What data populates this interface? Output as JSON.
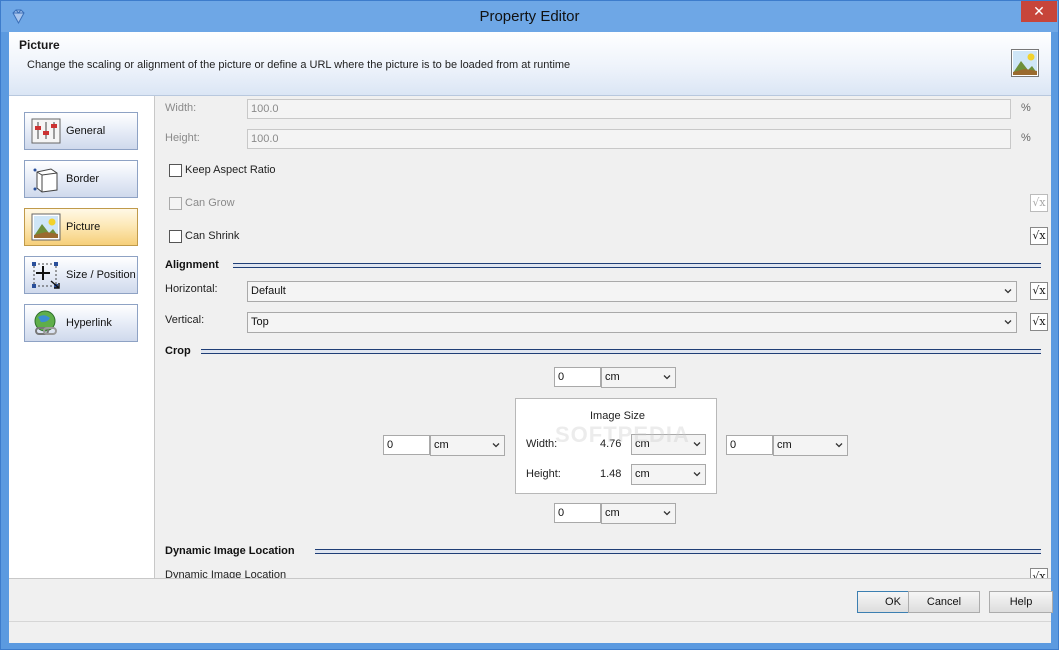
{
  "window": {
    "title": "Property Editor",
    "close_label": "✕"
  },
  "header": {
    "title": "Picture",
    "description": "Change the scaling or alignment of the picture or define a URL where the picture is to be loaded from at runtime"
  },
  "nav": {
    "items": [
      {
        "label": "General",
        "icon": "sliders-icon",
        "active": false
      },
      {
        "label": "Border",
        "icon": "border-box-icon",
        "active": false
      },
      {
        "label": "Picture",
        "icon": "picture-icon",
        "active": true
      },
      {
        "label": "Size / Position",
        "icon": "move-resize-icon",
        "active": false
      },
      {
        "label": "Hyperlink",
        "icon": "globe-link-icon",
        "active": false
      }
    ]
  },
  "scaling": {
    "width_label": "Width:",
    "width_value": "100.0",
    "width_unit": "%",
    "height_label": "Height:",
    "height_value": "100.0",
    "height_unit": "%"
  },
  "options": {
    "keep_aspect_ratio": "Keep Aspect Ratio",
    "can_grow": "Can Grow",
    "can_shrink": "Can Shrink",
    "fx_symbol": "√x"
  },
  "alignment": {
    "section": "Alignment",
    "horizontal_label": "Horizontal:",
    "horizontal_value": "Default",
    "vertical_label": "Vertical:",
    "vertical_value": "Top"
  },
  "crop": {
    "section": "Crop",
    "top_value": "0",
    "top_unit": "cm",
    "left_value": "0",
    "left_unit": "cm",
    "right_value": "0",
    "right_unit": "cm",
    "bottom_value": "0",
    "bottom_unit": "cm",
    "image_size": {
      "title": "Image Size",
      "width_label": "Width:",
      "width_value": "4.76",
      "width_unit": "cm",
      "height_label": "Height:",
      "height_value": "1.48",
      "height_unit": "cm"
    },
    "watermark": "SOFTPEDIA"
  },
  "dynamic": {
    "section": "Dynamic Image Location",
    "label": "Dynamic Image Location"
  },
  "buttons": {
    "ok": "OK",
    "cancel": "Cancel",
    "help": "Help"
  }
}
